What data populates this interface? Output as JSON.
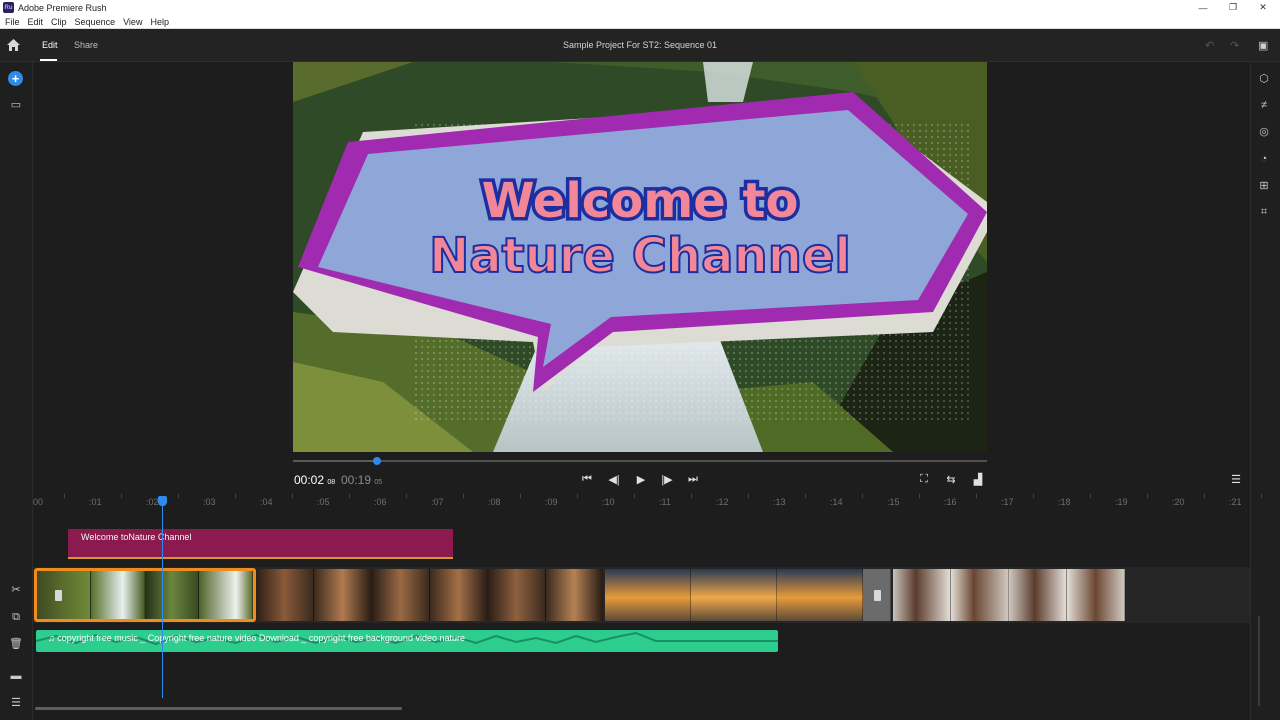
{
  "window": {
    "app_title": "Adobe Premiere Rush",
    "app_icon_text": "Ru"
  },
  "menu": [
    "File",
    "Edit",
    "Clip",
    "Sequence",
    "View",
    "Help"
  ],
  "topbar": {
    "tabs": [
      "Edit",
      "Share"
    ],
    "active_tab": "Edit",
    "project_title": "Sample Project For ST2: Sequence 01"
  },
  "preview": {
    "title_line1": "Welcome to",
    "title_line2": "Nature Channel"
  },
  "playback": {
    "current_time": "00:02",
    "current_frames": "08",
    "duration_time": "00:19",
    "duration_frames": "05",
    "progress": 0.121
  },
  "ruler_labels": [
    "00",
    ":01",
    ":02",
    ":03",
    ":04",
    ":05",
    ":06",
    ":07",
    ":08",
    ":09",
    ":10",
    ":11",
    ":12",
    ":13",
    ":14",
    ":15",
    ":16",
    ":17",
    ":18",
    ":19",
    ":20",
    ":21"
  ],
  "timeline": {
    "title_clip": "Welcome toNature Channel",
    "audio_clip": "♫ copyright free music _ Copyright free nature video Download _ copyright free background video nature"
  },
  "colors": {
    "accent": "#2d8ceb",
    "title_clip": "#8b1a4e",
    "audio_clip": "#2dcc8f",
    "selection": "#f08c1e"
  }
}
